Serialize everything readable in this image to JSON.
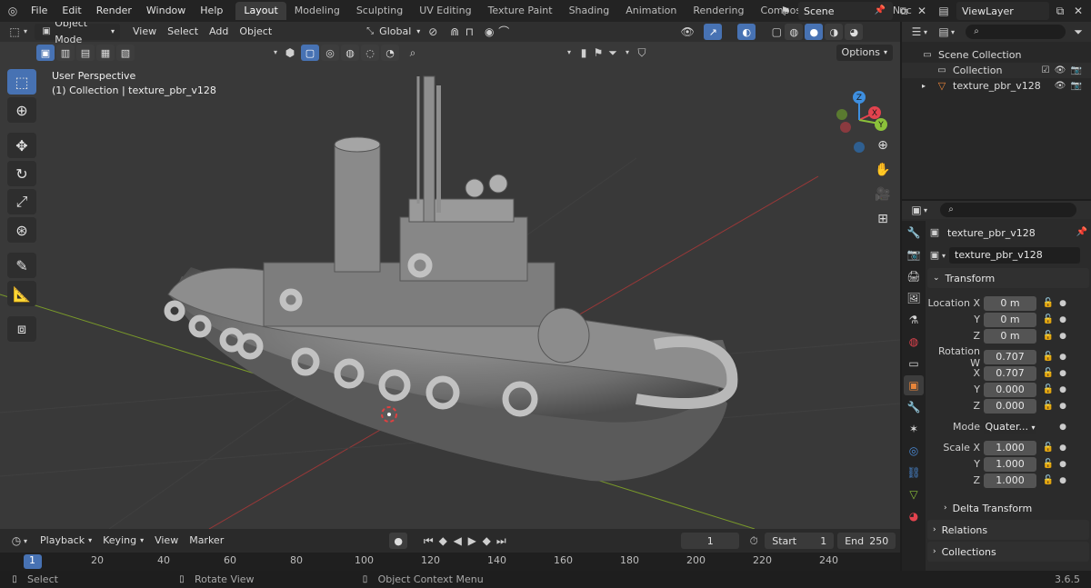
{
  "topbar": {
    "menus": [
      "File",
      "Edit",
      "Render",
      "Window",
      "Help"
    ],
    "workspaces": [
      "Layout",
      "Modeling",
      "Sculpting",
      "UV Editing",
      "Texture Paint",
      "Shading",
      "Animation",
      "Rendering",
      "Compositing",
      "Geometry Noc"
    ],
    "active_workspace": "Layout",
    "scene": "Scene",
    "view_layer": "ViewLayer"
  },
  "viewport": {
    "mode": "Object Mode",
    "menus": [
      "View",
      "Select",
      "Add",
      "Object"
    ],
    "orientation": "Global",
    "options_label": "Options",
    "info_line1": "User Perspective",
    "info_line2": "(1) Collection | texture_pbr_v128"
  },
  "gizmo": {
    "x": "X",
    "y": "Y",
    "z": "Z"
  },
  "timeline": {
    "menus": [
      "Playback",
      "Keying",
      "View",
      "Marker"
    ],
    "current_frame": "1",
    "start_label": "Start",
    "start": "1",
    "end_label": "End",
    "end": "250",
    "ruler": [
      "1",
      "20",
      "40",
      "60",
      "80",
      "100",
      "120",
      "140",
      "160",
      "180",
      "200",
      "220",
      "240"
    ]
  },
  "status": {
    "select": "Select",
    "rotate": "Rotate View",
    "context": "Object Context Menu",
    "version": "3.6.5"
  },
  "outliner": {
    "scene_collection": "Scene Collection",
    "collection": "Collection",
    "object": "texture_pbr_v128"
  },
  "properties": {
    "object_name": "texture_pbr_v128",
    "object_field": "texture_pbr_v128",
    "transform_title": "Transform",
    "location": {
      "label_x": "Location X",
      "label_y": "Y",
      "label_z": "Z",
      "x": "0 m",
      "y": "0 m",
      "z": "0 m"
    },
    "rotation": {
      "label_w": "Rotation W",
      "label_x": "X",
      "label_y": "Y",
      "label_z": "Z",
      "w": "0.707",
      "x": "0.707",
      "y": "0.000",
      "z": "0.000"
    },
    "mode_label": "Mode",
    "mode_value": "Quater...",
    "scale": {
      "label_x": "Scale X",
      "label_y": "Y",
      "label_z": "Z",
      "x": "1.000",
      "y": "1.000",
      "z": "1.000"
    },
    "delta_transform": "Delta Transform",
    "relations": "Relations",
    "collections": "Collections"
  },
  "colors": {
    "accent": "#4772b3",
    "axis_x": "#e3434e",
    "axis_y": "#8bc13a",
    "axis_z": "#3e8fe0",
    "object_orange": "#e8853a"
  }
}
